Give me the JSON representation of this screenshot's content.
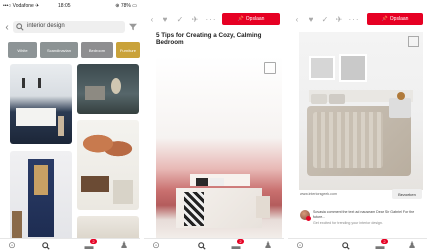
{
  "screen1": {
    "status": {
      "carrier": "•••○ Vodafone ✈",
      "time": "18:05",
      "battery": "⊕ 78% ▭"
    },
    "search": {
      "query": "interior design"
    },
    "chips": [
      {
        "label": "White",
        "color": "#8d9496"
      },
      {
        "label": "Scandinavian",
        "color": "#8c9394"
      },
      {
        "label": "Bedroom",
        "color": "#8e8e90"
      },
      {
        "label": "Furniture",
        "color": "#c9a23a"
      }
    ],
    "nav": {
      "badge_count": "2"
    }
  },
  "screen2": {
    "save_label": "Opslaan",
    "title": "5 Tips for Creating a Cozy, Calming Bedroom",
    "nav": {
      "badge_count": "2"
    }
  },
  "screen3": {
    "save_label": "Opslaan",
    "source_url": "www.interiorsgeek.com",
    "visit_label": "Bezoeken",
    "comment_text": "Sovasia comment the text ad nauseam Dear Sir Gabriel For the future...",
    "comment_sub": "Get excited for trending your interior design.",
    "nav": {
      "badge_count": "2"
    }
  },
  "colors": {
    "accent": "#e60023"
  }
}
